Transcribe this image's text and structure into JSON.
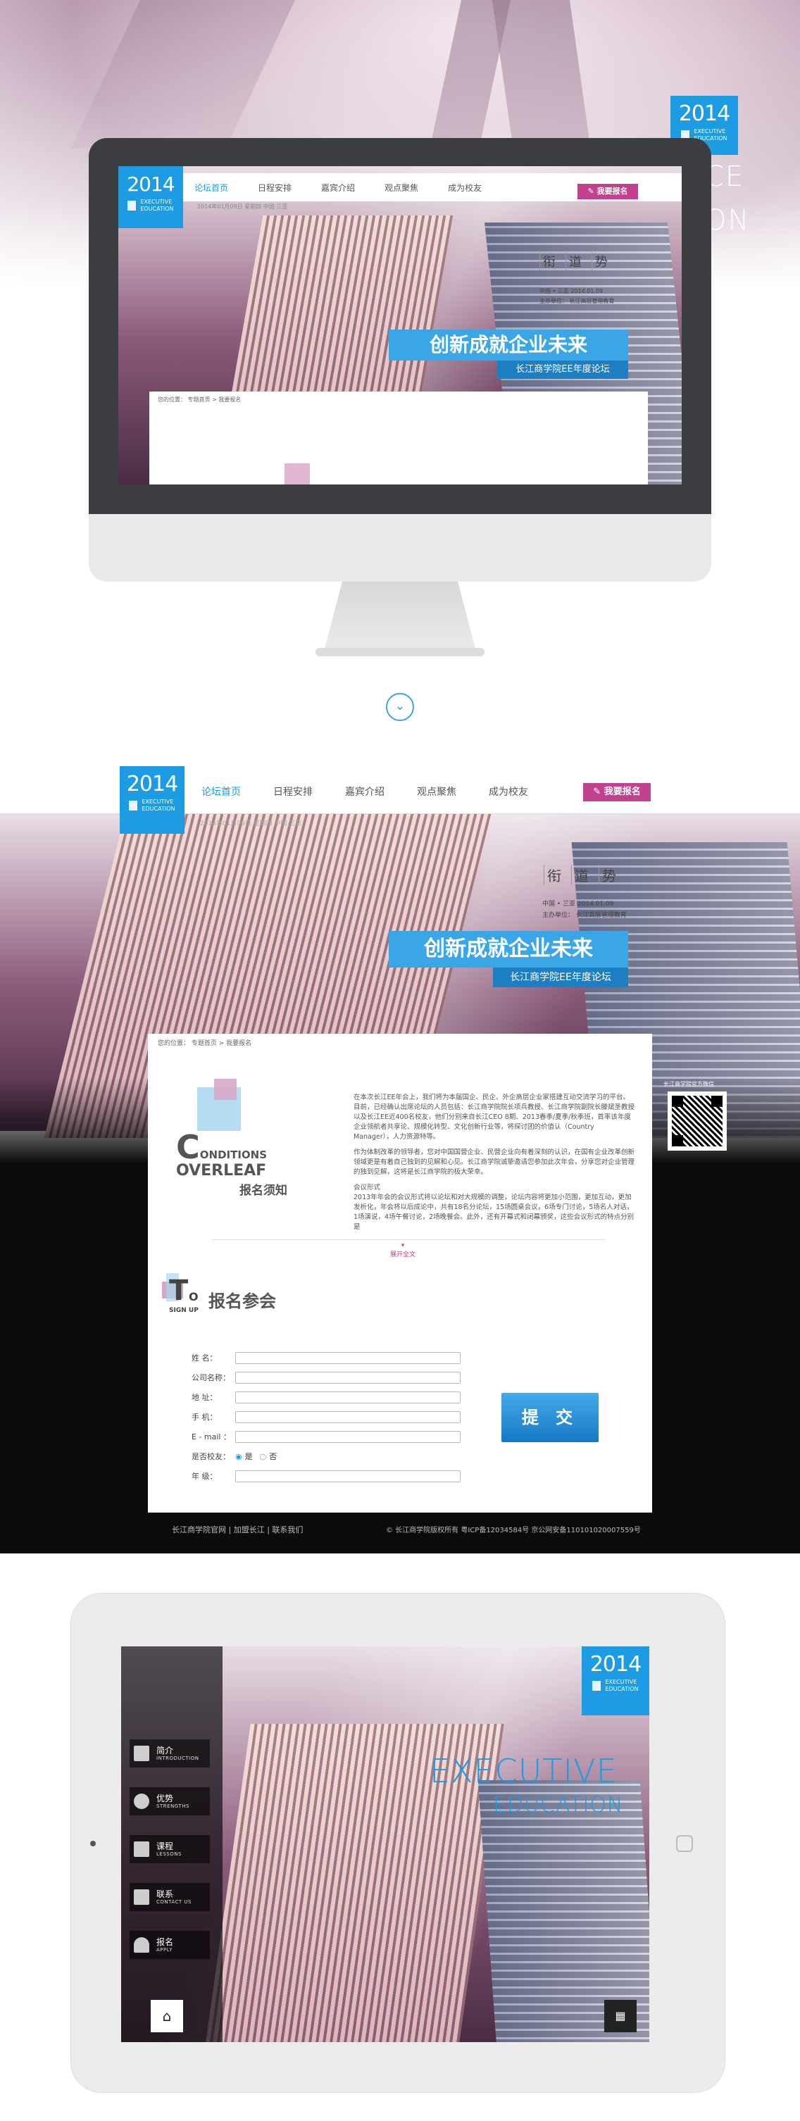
{
  "brand": {
    "year": "2014",
    "line1": "EXECUTIVE",
    "line2": "EDUCATION"
  },
  "hero": {
    "bg_word": "CE",
    "bg_word2": "ON"
  },
  "nav": {
    "items": [
      "论坛首页",
      "日程安排",
      "嘉宾介绍",
      "观点聚焦",
      "成为校友"
    ],
    "apply": "我要报名",
    "info": "2014年01月09日  星期四  中国·三亚"
  },
  "banner": {
    "calligraphy": [
      "衔",
      "道",
      "势"
    ],
    "event_line": "中国 • 三亚    2014.01.09",
    "host_line": "主办单位：  长江高层管理教育",
    "slogan": "创新成就企业未来",
    "sub_slogan": "长江商学院EE年度论坛"
  },
  "breadcrumb": "您的位置：  专题首页  >  我要报名",
  "conditions": {
    "title_big": "C",
    "title_rest": "ONDITIONS",
    "title2": "OVERLEAF",
    "title_cn": "报名须知",
    "para1": "在本次长江EE年会上，我们将为本届国企、民企、外企高层企业家搭建互动交流学习的平台。目前，已经确认出席论坛的人员包括：长江商学院院长项兵教授、长江商学院副院长滕斌圣教授以及长江EE近400名校友，他们分别来自长江CEO 8期、2013春季/夏季/秋季班，首率该年度企业领航者共享论、规模化转型、文化创新行业等，将探讨团的价值认（Country Manager），人力资源特等。",
    "para2": "作为体制改革的领导者，您对中国国营企业、民营企业向有着深刻的认识，在国有企业改革创新领域更是有着自己独到的见解和心见。长江商学院诚挚邀请您参加此次年会，分享您对企业管理的独到见解，这将是长江商学院的极大荣幸。",
    "para3_head": "会议形式",
    "para3": "2013年年会的会议形式将以论坛和对大规模的调整，论坛内容将更加小范围，更加互动，更加发析化，年会将以后成论中，共有18名分论坛，15场圆桌会议，6场专门讨论，5场名人对话，1场演说，4场午餐讨论，2场晚餐会。此外，还有开幕式和闭幕颁奖，这些会议形式的特点分别是",
    "expand": "展开全文"
  },
  "signup": {
    "title_big": "T",
    "title_o": "O",
    "title_sub": "SIGN UP",
    "title_cn": "报名参会",
    "fields": [
      {
        "label": "姓      名："
      },
      {
        "label": "公司名称："
      },
      {
        "label": "地      址："
      },
      {
        "label": "手      机："
      },
      {
        "label": "E - mail ："
      }
    ],
    "alumni_label": "是否校友：",
    "alumni_yes": "是",
    "alumni_no": "否",
    "age_label": "年      级：",
    "submit": "提 交"
  },
  "qr": {
    "caption": "长江商学院官方微信"
  },
  "footer": {
    "left": "长江商学院官网  |  加盟长江  |  联系我们",
    "right": "© 长江商学院版权所有  粤ICP备12034584号  京公网安备110101020007559号"
  },
  "tablet": {
    "menu": [
      {
        "cn": "简介",
        "en": "INTRODUCTION"
      },
      {
        "cn": "优势",
        "en": "STRENGTHS"
      },
      {
        "cn": "课程",
        "en": "LESSONS"
      },
      {
        "cn": "联系",
        "en": "CONTACT US"
      },
      {
        "cn": "报名",
        "en": "APPLY"
      }
    ],
    "headline1": "EXECUTIVE",
    "headline2": "EDUCATION",
    "home_icon": "⌂",
    "grid_icon": "▦"
  },
  "colors": {
    "accent": "#1d9be3",
    "apply": "#c2418f",
    "dark": "#0c0a0c"
  }
}
